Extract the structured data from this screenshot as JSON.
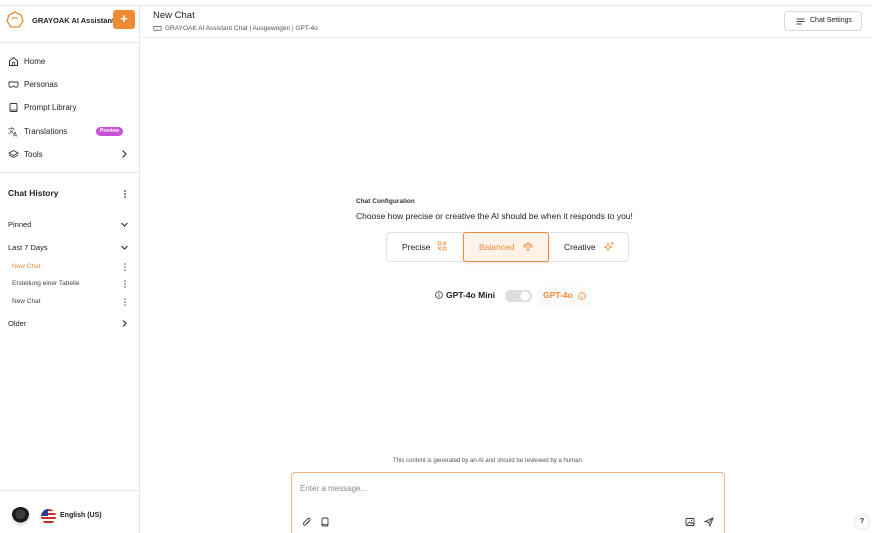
{
  "brand": {
    "name": "GRAYOAK AI Assistant",
    "new_button": "+",
    "accent": "#ef8a34"
  },
  "sidebar": {
    "nav": [
      {
        "label": "Home",
        "icon": "home-icon"
      },
      {
        "label": "Personas",
        "icon": "mask-icon"
      },
      {
        "label": "Prompt Library",
        "icon": "book-icon"
      },
      {
        "label": "Translations",
        "icon": "translate-icon",
        "badge": "Preview"
      },
      {
        "label": "Tools",
        "icon": "layers-icon"
      }
    ],
    "history_title": "Chat History",
    "groups": {
      "pinned": "Pinned",
      "last7": "Last 7 Days",
      "older": "Older"
    },
    "chats": [
      {
        "label": "New Chat",
        "active": true
      },
      {
        "label": "Erstellung einer Tabelle",
        "active": false
      },
      {
        "label": "New Chat",
        "active": false
      }
    ],
    "language": "English (US)"
  },
  "header": {
    "title": "New Chat",
    "subtitle": "GRAYOAK AI Assistant Chat | Ausgewogen | GPT-4o",
    "settings_label": "Chat Settings"
  },
  "config": {
    "label": "Chat Configuration",
    "description": "Choose how precise or creative the AI should be when it responds to you!",
    "modes": [
      "Precise",
      "Balanced",
      "Creative"
    ],
    "selected_mode": "Balanced"
  },
  "models": {
    "option_a": "GPT-4o Mini",
    "option_b": "GPT-4o",
    "selected": "GPT-4o"
  },
  "composer": {
    "disclaimer": "This content is generated by an AI and should be reviewed by a human.",
    "placeholder": "Enter a message..."
  },
  "help_label": "?"
}
